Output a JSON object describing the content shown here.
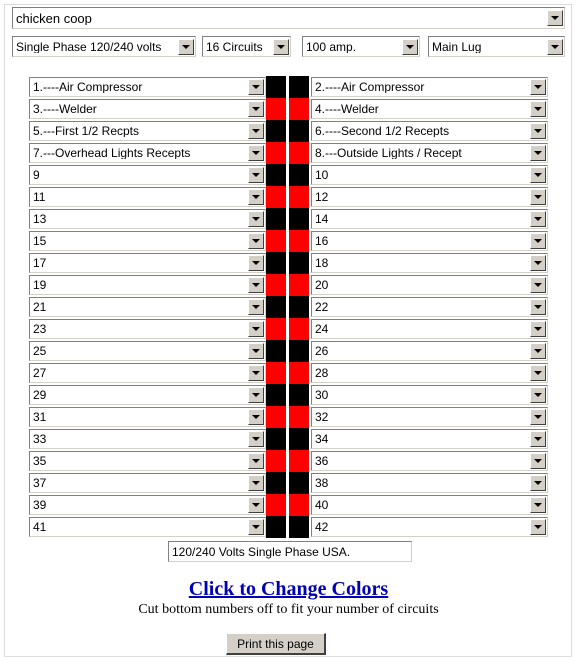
{
  "panel_name": {
    "value": "chicken coop",
    "icon": "chevron-down-icon"
  },
  "options": {
    "phase": "Single Phase 120/240 volts",
    "circuits": "16 Circuits",
    "amperage": "100 amp.",
    "service_type": "Main Lug"
  },
  "colors": {
    "black": "#000000",
    "red": "#ff0000",
    "link": "#0000bb",
    "button_face": "#d4d0c8"
  },
  "circuits": {
    "left": [
      "1.----Air Compressor",
      "3.----Welder",
      "5.---First 1/2 Recpts",
      "7.---Overhead Lights Recepts",
      "9",
      "11",
      "13",
      "15",
      "17",
      "19",
      "21",
      "23",
      "25",
      "27",
      "29",
      "31",
      "33",
      "35",
      "37",
      "39",
      "41"
    ],
    "right": [
      "2.----Air Compressor",
      "4.----Welder",
      "6.----Second 1/2 Recepts",
      "8.---Outside Lights / Recept",
      "10",
      "12",
      "14",
      "16",
      "18",
      "20",
      "22",
      "24",
      "26",
      "28",
      "30",
      "32",
      "34",
      "36",
      "38",
      "40",
      "42"
    ],
    "bus_colors": [
      "#000000",
      "#ff0000",
      "#000000",
      "#ff0000",
      "#000000",
      "#ff0000",
      "#000000",
      "#ff0000",
      "#000000",
      "#ff0000",
      "#000000",
      "#ff0000",
      "#000000",
      "#ff0000",
      "#000000",
      "#ff0000",
      "#000000",
      "#ff0000",
      "#000000",
      "#ff0000",
      "#000000"
    ]
  },
  "footer": {
    "note_value": "120/240 Volts Single Phase USA.",
    "change_colors_label": "Click to Change Colors",
    "cut_note": "Cut bottom numbers off to fit your number of circuits",
    "print_label": "Print this page"
  }
}
